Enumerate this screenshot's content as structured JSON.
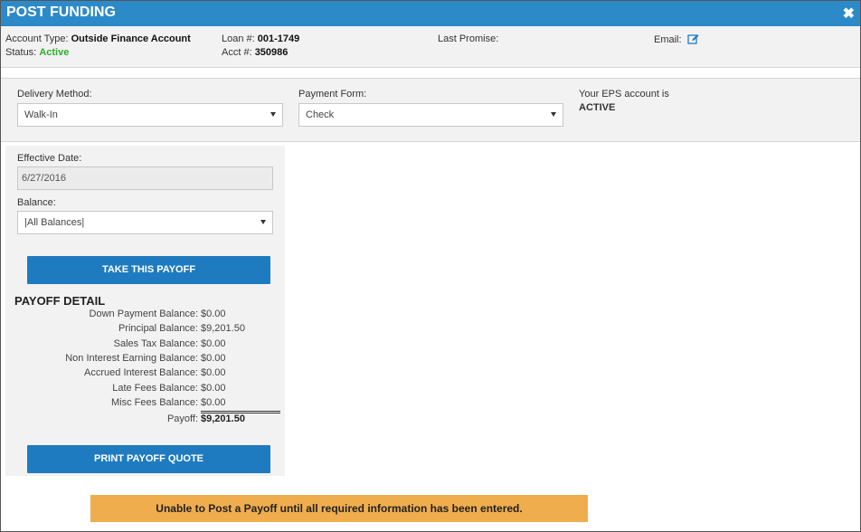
{
  "window": {
    "title": "POST FUNDING",
    "close_label": "✖"
  },
  "account": {
    "type_label": "Account Type:",
    "type_value": "Outside Finance Account",
    "status_label": "Status:",
    "status_value": "Active",
    "loan_label": "Loan #:",
    "loan_value": "001-1749",
    "acct_label": "Acct #:",
    "acct_value": "350986",
    "last_promise_label": "Last Promise:",
    "email_label": "Email:"
  },
  "delivery": {
    "method_label": "Delivery Method:",
    "method_value": "Walk-In",
    "payment_form_label": "Payment Form:",
    "payment_form_value": "Check",
    "eps_text": "Your EPS account is",
    "eps_status": "ACTIVE"
  },
  "payoff": {
    "effective_date_label": "Effective Date:",
    "effective_date_value": "6/27/2016",
    "balance_label": "Balance:",
    "balance_value": "|All Balances|",
    "take_payoff_button": "TAKE THIS PAYOFF",
    "detail_title": "PAYOFF DETAIL",
    "rows": [
      {
        "label": "Down Payment Balance:",
        "value": "$0.00"
      },
      {
        "label": "Principal Balance:",
        "value": "$9,201.50"
      },
      {
        "label": "Sales Tax Balance:",
        "value": "$0.00"
      },
      {
        "label": "Non Interest Earning Balance:",
        "value": "$0.00"
      },
      {
        "label": "Accrued Interest Balance:",
        "value": "$0.00"
      },
      {
        "label": "Late Fees Balance:",
        "value": "$0.00"
      },
      {
        "label": "Misc Fees Balance:",
        "value": "$0.00"
      }
    ],
    "total_label": "Payoff:",
    "total_value": "$9,201.50",
    "print_button": "PRINT PAYOFF QUOTE"
  },
  "warning": "Unable to Post a Payoff until all required information has been entered.",
  "colors": {
    "header": "#2d8ac9",
    "button": "#1f7bbf",
    "active_green": "#2cae2c",
    "warning": "#f0ad4e"
  },
  "icons": [
    "close-icon",
    "edit-icon",
    "chevron-down-icon"
  ]
}
